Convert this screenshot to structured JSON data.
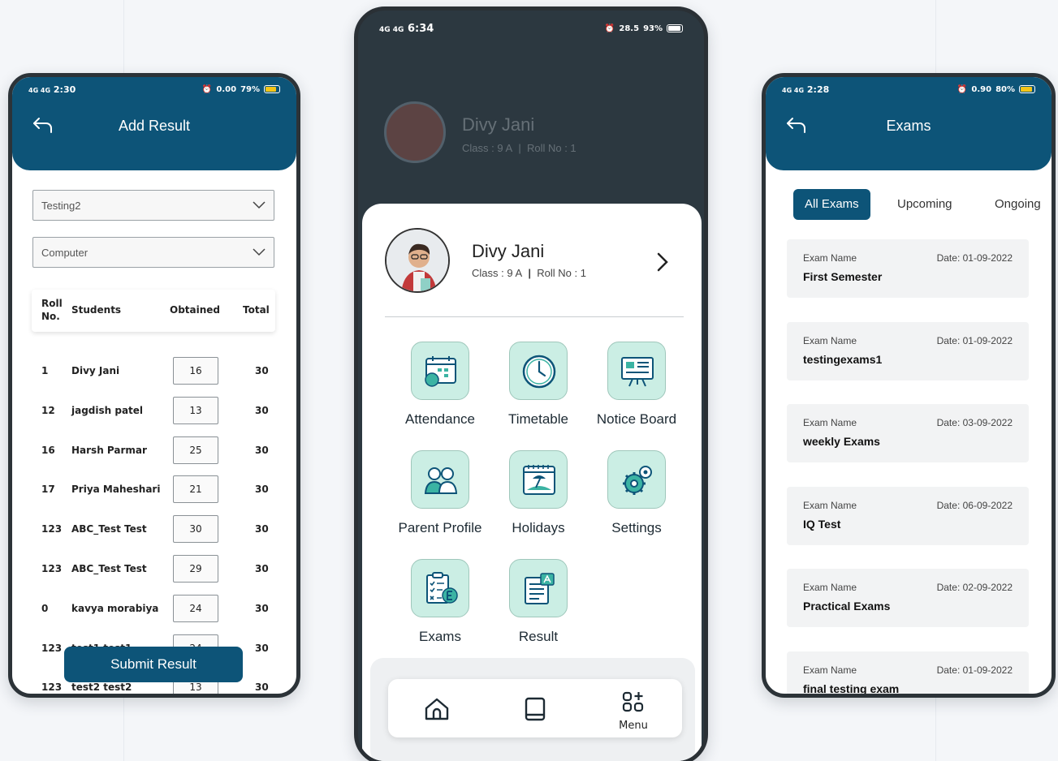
{
  "left_phone": {
    "status": {
      "signal": "4G 4G",
      "time": "2:30",
      "speed": "0.00",
      "battery": "79%"
    },
    "title": "Add Result",
    "selects": [
      {
        "value": "Testing2"
      },
      {
        "value": "Computer"
      }
    ],
    "columns": {
      "roll": "Roll\nNo.",
      "students": "Students",
      "obtained": "Obtained",
      "total": "Total"
    },
    "rows": [
      {
        "roll": "1",
        "name": "Divy Jani",
        "obtained": "16",
        "total": "30"
      },
      {
        "roll": "12",
        "name": "jagdish patel",
        "obtained": "13",
        "total": "30"
      },
      {
        "roll": "16",
        "name": "Harsh Parmar",
        "obtained": "25",
        "total": "30"
      },
      {
        "roll": "17",
        "name": "Priya Maheshari",
        "obtained": "21",
        "total": "30"
      },
      {
        "roll": "123",
        "name": "ABC_Test Test",
        "obtained": "30",
        "total": "30"
      },
      {
        "roll": "123",
        "name": "ABC_Test Test",
        "obtained": "29",
        "total": "30"
      },
      {
        "roll": "0",
        "name": "kavya morabiya",
        "obtained": "24",
        "total": "30"
      },
      {
        "roll": "123",
        "name": "test1 test1",
        "obtained": "24",
        "total": "30"
      },
      {
        "roll": "123",
        "name": "test2 test2",
        "obtained": "13",
        "total": "30"
      }
    ],
    "submit_label": "Submit Result"
  },
  "middle_phone": {
    "status": {
      "signal": "4G 4G",
      "time": "6:34",
      "speed": "28.5",
      "battery": "93%"
    },
    "profile": {
      "name": "Divy Jani",
      "class": "Class : 9 A",
      "roll": "Roll No : 1"
    },
    "tiles": [
      {
        "label": "Attendance",
        "icon": "attendance-icon"
      },
      {
        "label": "Timetable",
        "icon": "clock-icon"
      },
      {
        "label": "Notice Board",
        "icon": "notice-board-icon"
      },
      {
        "label": "Parent Profile",
        "icon": "parents-icon"
      },
      {
        "label": "Holidays",
        "icon": "holiday-calendar-icon"
      },
      {
        "label": "Settings",
        "icon": "gear-icon"
      },
      {
        "label": "Exams",
        "icon": "exam-checklist-icon"
      },
      {
        "label": "Result",
        "icon": "result-document-icon"
      }
    ],
    "nav": {
      "menu_label": "Menu"
    }
  },
  "right_phone": {
    "status": {
      "signal": "4G 4G",
      "time": "2:28",
      "speed": "0.90",
      "battery": "80%"
    },
    "title": "Exams",
    "tabs": [
      "All Exams",
      "Upcoming",
      "Ongoing"
    ],
    "exam_key": "Exam Name",
    "exams": [
      {
        "name": "First Semester",
        "date": "Date: 01-09-2022"
      },
      {
        "name": "testingexams1",
        "date": "Date: 01-09-2022"
      },
      {
        "name": "weekly Exams",
        "date": "Date: 03-09-2022"
      },
      {
        "name": "IQ Test",
        "date": "Date: 06-09-2022"
      },
      {
        "name": "Practical Exams",
        "date": "Date: 02-09-2022"
      },
      {
        "name": "final testing exam",
        "date": "Date: 01-09-2022"
      }
    ]
  },
  "colors": {
    "primary": "#0d5478",
    "tile_bg": "#cbeee4",
    "frame": "#2c3338"
  }
}
